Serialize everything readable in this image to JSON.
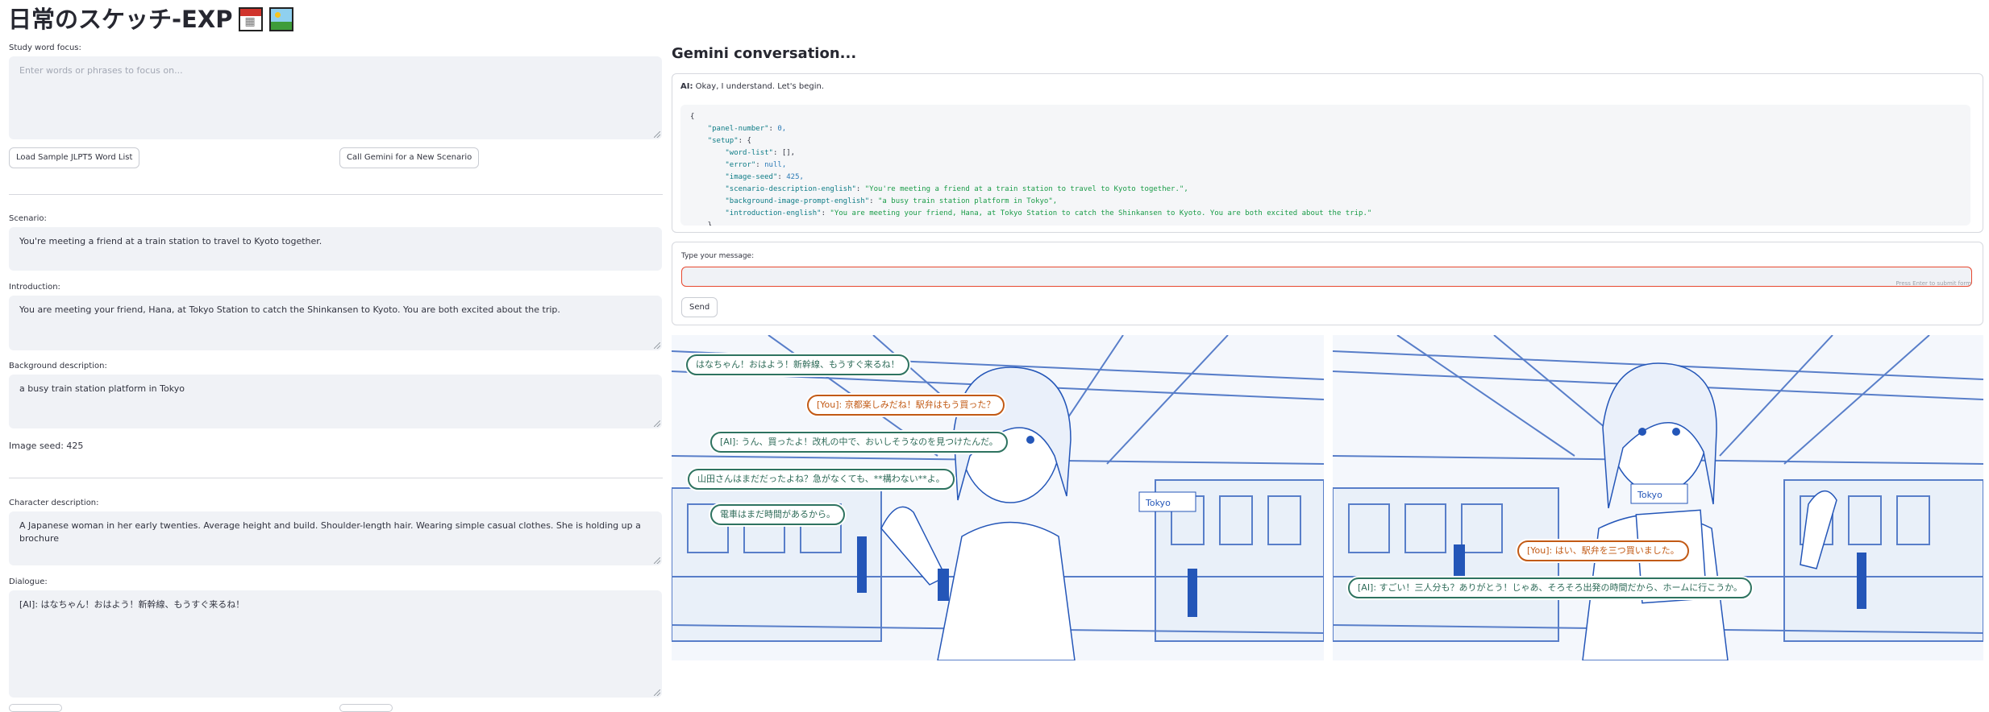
{
  "app": {
    "title": "日常のスケッチ-EXP",
    "title_icons": [
      "calendar-icon",
      "framed-picture-icon"
    ]
  },
  "left": {
    "study_label": "Study word focus:",
    "study_placeholder": "Enter words or phrases to focus on...",
    "load_button": "Load Sample JLPT5 Word List",
    "call_button": "Call Gemini for a New Scenario",
    "scenario_label": "Scenario:",
    "scenario_value": "You're meeting a friend at a train station to travel to Kyoto together.",
    "intro_label": "Introduction:",
    "intro_value": "You are meeting your friend, Hana, at Tokyo Station to catch the Shinkansen to Kyoto. You are both excited about the trip.",
    "background_label": "Background description:",
    "background_value": "a busy train station platform in Tokyo",
    "image_seed_text": "Image seed: 425",
    "character_label": "Character description:",
    "character_value": "A Japanese woman in her early twenties. Average height and build. Shoulder-length hair. Wearing simple casual clothes. She is holding up a brochure",
    "dialogue_label": "Dialogue:",
    "dialogue_value": "[AI]: はなちゃん！おはよう！新幹線、もうすぐ来るね！"
  },
  "conversation": {
    "heading": "Gemini conversation...",
    "ai_prefix": "AI:",
    "ai_message": "Okay, I understand. Let's begin.",
    "code_lines": [
      {
        "t": "p",
        "v": "{"
      },
      {
        "t": "kv",
        "indent": "    ",
        "k": "\"panel-number\"",
        "v": "0,",
        "vt": "n"
      },
      {
        "t": "kv",
        "indent": "    ",
        "k": "\"setup\"",
        "v": "{",
        "vt": "p"
      },
      {
        "t": "kv",
        "indent": "        ",
        "k": "\"word-list\"",
        "v": "[],",
        "vt": "p"
      },
      {
        "t": "kv",
        "indent": "        ",
        "k": "\"error\"",
        "v": "null,",
        "vt": "n"
      },
      {
        "t": "kv",
        "indent": "        ",
        "k": "\"image-seed\"",
        "v": "425,",
        "vt": "n"
      },
      {
        "t": "kv",
        "indent": "        ",
        "k": "\"scenario-description-english\"",
        "v": "\"You're meeting a friend at a train station to travel to Kyoto together.\",",
        "vt": "s"
      },
      {
        "t": "kv",
        "indent": "        ",
        "k": "\"background-image-prompt-english\"",
        "v": "\"a busy train station platform in Tokyo\",",
        "vt": "s"
      },
      {
        "t": "kv",
        "indent": "        ",
        "k": "\"introduction-english\"",
        "v": "\"You are meeting your friend, Hana, at Tokyo Station to catch the Shinkansen to Kyoto. You are both excited about the trip.\"",
        "vt": "s"
      },
      {
        "t": "p",
        "v": "    }"
      }
    ],
    "input_label": "Type your message:",
    "input_value": "",
    "input_hint": "Press Enter to submit form",
    "send_button": "Send"
  },
  "panels": {
    "panel1_bubbles": [
      {
        "speaker": "ai",
        "text": "はなちゃん！おはよう！新幹線、もうすぐ来るね！"
      },
      {
        "speaker": "you",
        "text": "[You]: 京都楽しみだね！駅弁はもう買った？"
      },
      {
        "speaker": "ai",
        "text": "[AI]: うん、買ったよ！改札の中で、おいしそうなのを見つけたんだ。"
      },
      {
        "speaker": "ai",
        "text": "山田さんはまだだったよね？急がなくても、**構わない**よ。"
      },
      {
        "speaker": "ai",
        "text": "電車はまだ時間があるから。"
      }
    ],
    "panel2_bubbles": [
      {
        "speaker": "you",
        "text": "[You]: はい、駅弁を三つ買いました。"
      },
      {
        "speaker": "ai",
        "text": "[AI]: すごい！三人分も？ありがとう！じゃあ、そろそろ出発の時間だから、ホームに行こうか。"
      }
    ],
    "sign_text": "Tokyo",
    "colors": {
      "ink": "#2456b8",
      "ai_border": "#2e7360",
      "you_border": "#c25a15"
    }
  }
}
